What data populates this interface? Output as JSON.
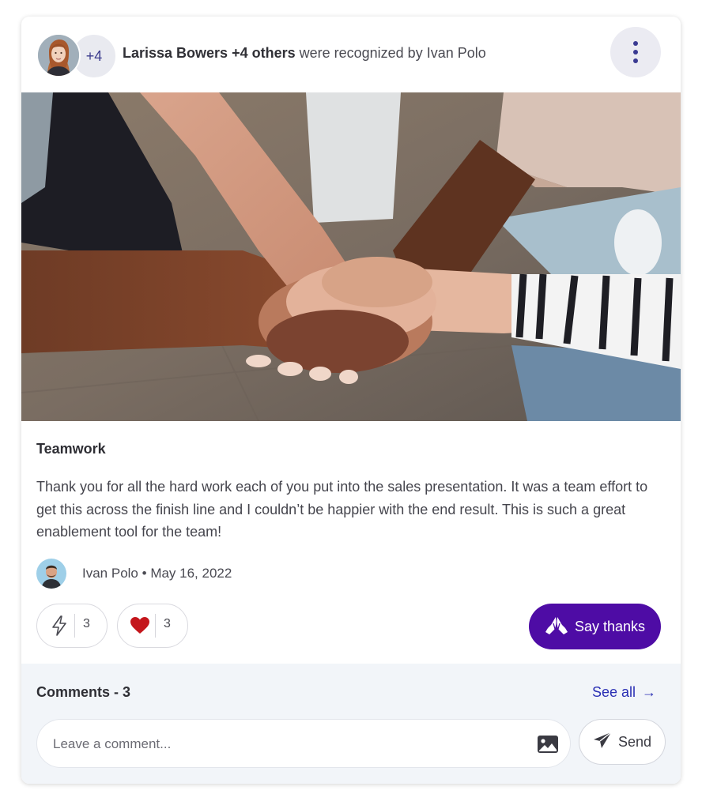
{
  "header": {
    "extra_count": "+4",
    "recipients": "Larissa Bowers +4 others",
    "action_text": " were recognized by Ivan Polo",
    "menu_icon": "more-vertical-icon"
  },
  "post": {
    "award": "Teamwork",
    "message": "Thank you for all the hard work each of you put into the sales presentation. It was a team effort to get this across the finish line and I couldn’t be happier with the end result. This is such a great enablement tool for the team!",
    "author": "Ivan Polo",
    "separator": "•",
    "date": "May 16, 2022"
  },
  "reactions": [
    {
      "icon": "lightning-icon",
      "count": "3"
    },
    {
      "icon": "heart-icon",
      "count": "3",
      "color": "#c4161c"
    }
  ],
  "thanks_button": {
    "label": "Say thanks",
    "icon": "praying-hands-icon",
    "color": "#4e0ca5"
  },
  "comments": {
    "title": "Comments - 3",
    "see_all": "See all",
    "see_all_arrow": "→",
    "placeholder": "Leave a comment...",
    "send_label": "Send"
  },
  "colors": {
    "accent": "#4e0ca5",
    "link": "#2a2fb4",
    "comments_bg": "#f2f5f9"
  }
}
